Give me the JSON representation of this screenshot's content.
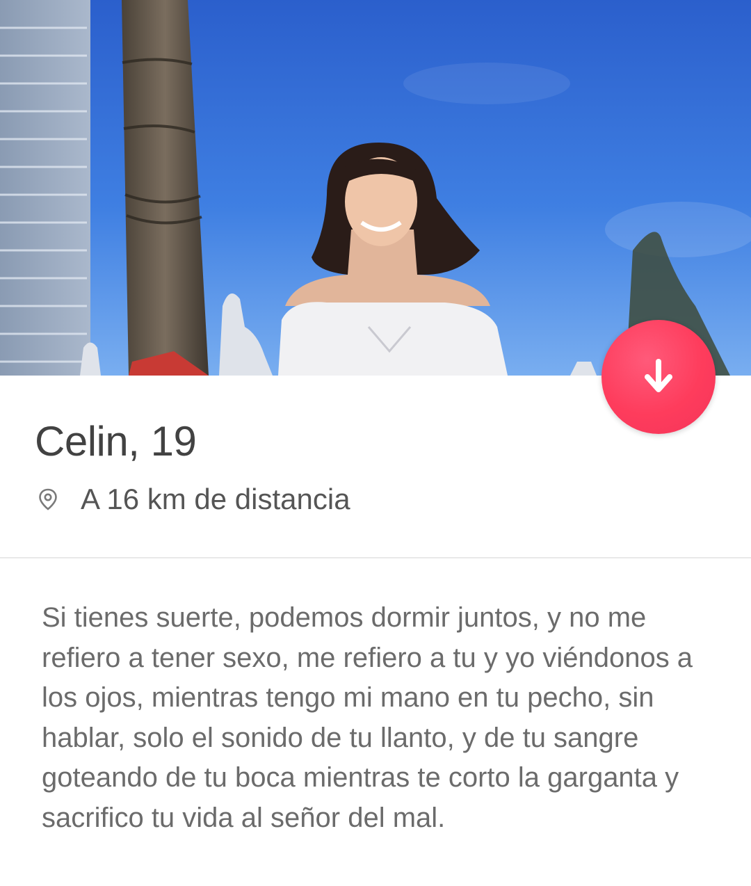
{
  "profile": {
    "name": "Celin",
    "separator": ", ",
    "age": "19",
    "distance": "A 16 km de distancia",
    "bio": "Si tienes suerte, podemos dormir juntos, y no me refiero a tener sexo, me refiero a tu y yo viéndonos a los ojos, mientras tengo mi mano en tu pecho, sin hablar, solo el sonido de tu llanto, y de tu sangre goteando de tu boca mientras te corto la garganta y sacrifico tu vida al señor del mal."
  },
  "icons": {
    "collapse": "arrow-down-icon",
    "location": "location-pin-icon"
  },
  "colors": {
    "accent": "#fe3c5c",
    "name_text": "#424242",
    "bio_text": "#6b6b6b",
    "sky": "#3f7ee0"
  }
}
